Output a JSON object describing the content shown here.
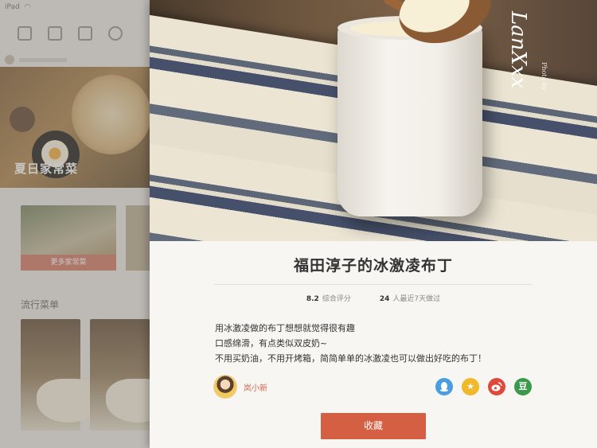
{
  "background_app": {
    "status_carrier": "iPad",
    "hero_title": "夏日家常菜",
    "card_button": "更多家常菜",
    "section_title": "流行菜单"
  },
  "recipe": {
    "title": "福田淳子的冰激凌布丁",
    "rating_value": "8.2",
    "rating_label": "综合评分",
    "cooks_value": "24",
    "cooks_label": "人最近7天做过",
    "description": [
      "用冰激凌做的布丁想想就觉得很有趣",
      "口感绵滑，有点类似双皮奶~",
      "不用买奶油，不用开烤箱，简简单单的冰激凌也可以做出好吃的布丁！"
    ],
    "photo_watermark": "LanXxx",
    "photo_watermark_small": "Photo by"
  },
  "author": {
    "name": "岚小新"
  },
  "share": {
    "qq_icon": "qq-icon",
    "qzone_icon": "qzone-star-icon",
    "weibo_icon": "weibo-icon",
    "douban_label": "豆"
  },
  "actions": {
    "favorite_label": "收藏"
  },
  "colors": {
    "accent": "#d55f42",
    "author": "#d0664f",
    "qq": "#4a9ee0",
    "qzone": "#f0b92b",
    "weibo": "#e0483a",
    "douban": "#3a9a4b"
  }
}
